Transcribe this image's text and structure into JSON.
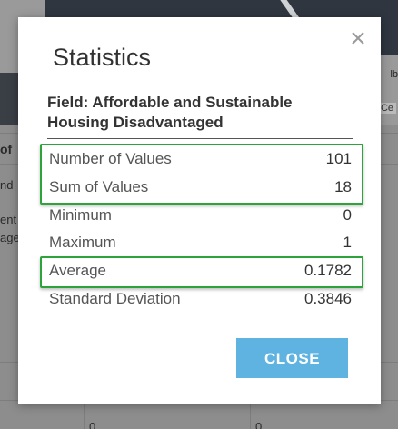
{
  "background": {
    "map_label": "Ce",
    "map_label_top": "lb",
    "left_fragments": [
      "of",
      "nd",
      "ent",
      "age"
    ],
    "table_zero_left": "0",
    "table_zero_right": "0"
  },
  "dialog": {
    "title": "Statistics",
    "close_icon": "close-icon",
    "field_label": "Field: Affordable and Sustainable Housing Disadvantaged",
    "stats": [
      {
        "name": "Number of Values",
        "value": "101"
      },
      {
        "name": "Sum of Values",
        "value": "18"
      },
      {
        "name": "Minimum",
        "value": "0"
      },
      {
        "name": "Maximum",
        "value": "1"
      },
      {
        "name": "Average",
        "value": "0.1782"
      },
      {
        "name": "Standard Deviation",
        "value": "0.3846"
      }
    ],
    "close_button_label": "CLOSE"
  },
  "colors": {
    "highlight": "#2ea33a",
    "button": "#5eb3e0",
    "overlay": "#8f8f8f"
  }
}
